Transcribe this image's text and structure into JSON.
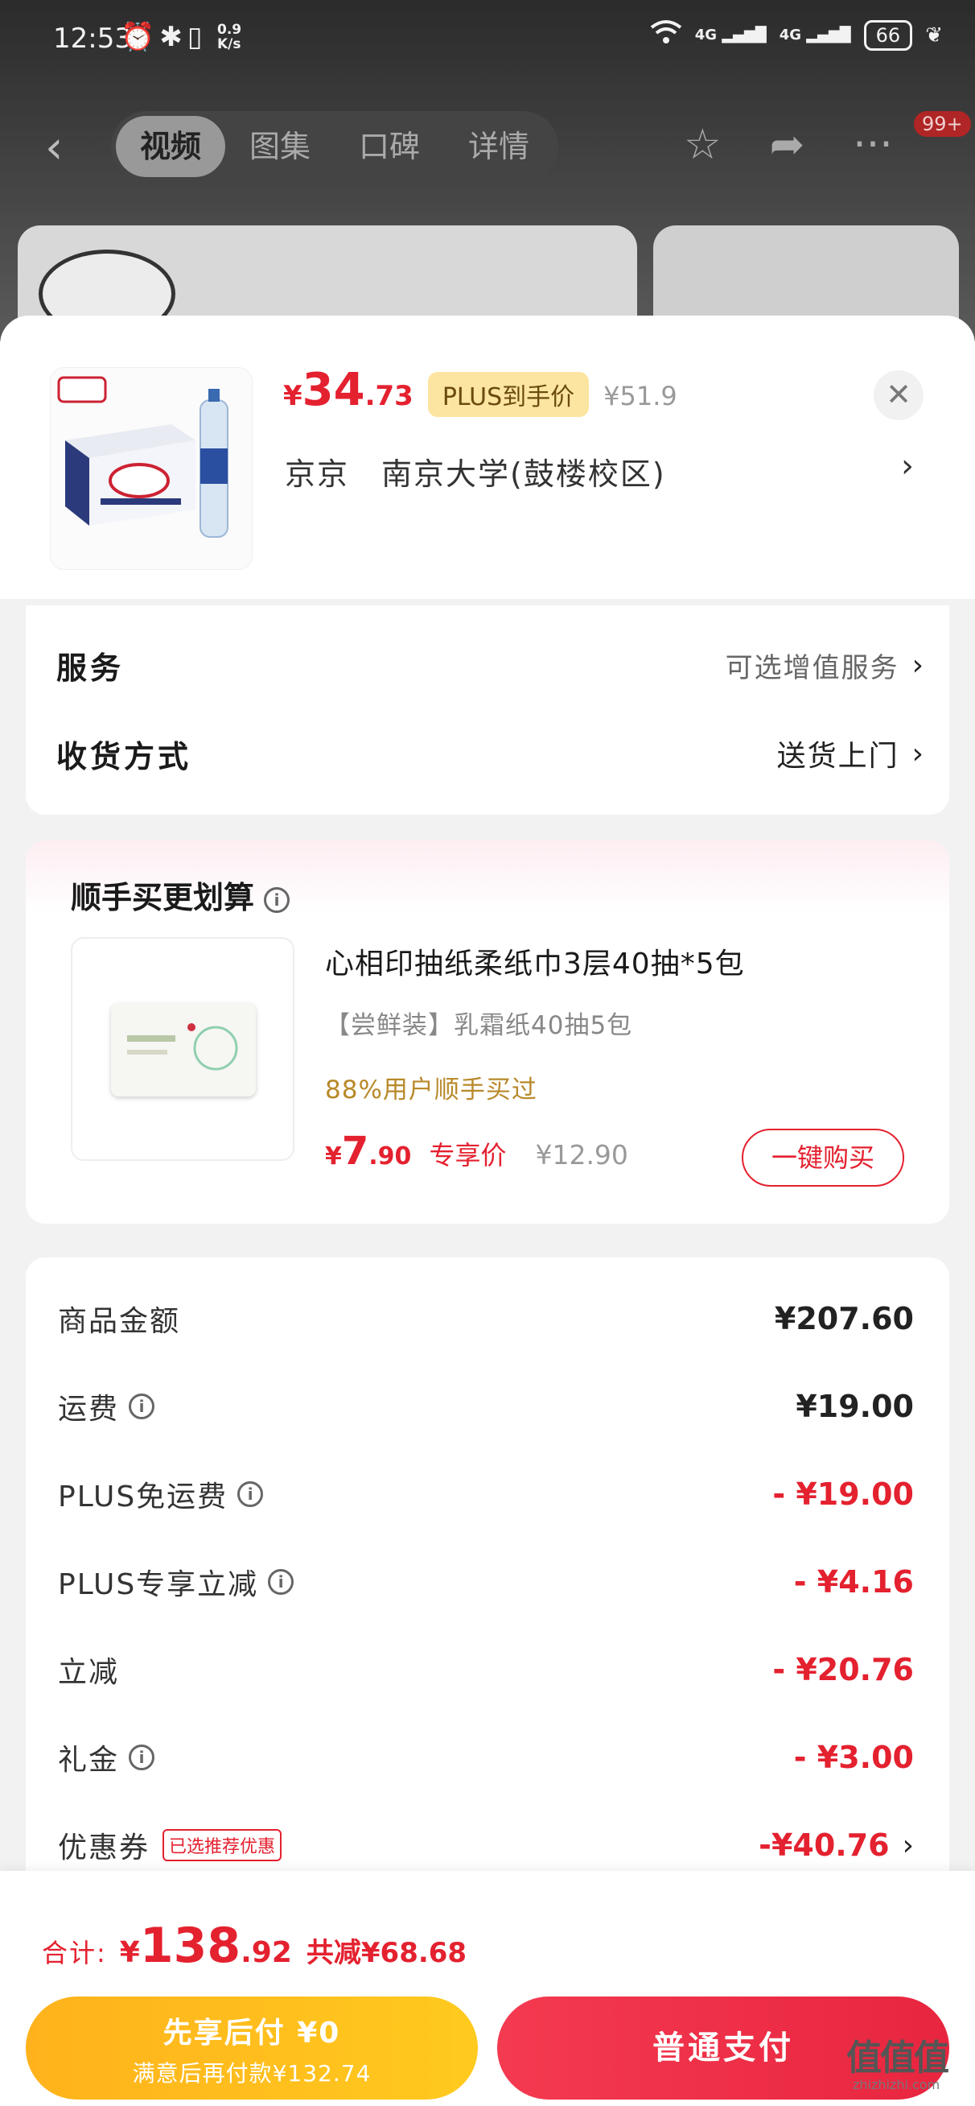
{
  "status_bar": {
    "time": "12:53",
    "speed_top": "0.9",
    "speed_unit": "K/s",
    "net1": "4G",
    "net2": "4G",
    "battery": "66"
  },
  "nav": {
    "tabs": [
      {
        "label": "视频"
      },
      {
        "label": "图集"
      },
      {
        "label": "口碑"
      },
      {
        "label": "详情"
      }
    ],
    "active_tab": "视频",
    "badge": "99+"
  },
  "product": {
    "price": {
      "currency": "¥",
      "integer": "34",
      "decimal": ".73"
    },
    "plus_tag": "PLUS到手价",
    "original_price": "¥51.9",
    "address": {
      "region": "京京",
      "detail": "南京大学(鼓楼校区)"
    }
  },
  "service": {
    "label": "服务",
    "value": "可选增值服务",
    "delivery_label": "收货方式",
    "delivery_value": "送货上门"
  },
  "recommend": {
    "title": "顺手买更划算",
    "name": "心相印抽纸柔纸巾3层40抽*5包",
    "spec": "【尝鲜装】乳霜纸40抽5包",
    "social": "88%用户顺手买过",
    "price": {
      "currency": "¥",
      "integer": "7",
      "decimal": ".90"
    },
    "exclusive": "专享价",
    "original_price": "¥12.90",
    "buy_button": "一键购买"
  },
  "summary": {
    "rows": [
      {
        "label": "商品金额",
        "value": "¥207.60"
      },
      {
        "label": "运费",
        "value": "¥19.00"
      },
      {
        "label": "PLUS免运费",
        "value": "- ¥19.00"
      },
      {
        "label": "PLUS专享立减",
        "value": "- ¥4.16"
      },
      {
        "label": "立减",
        "value": "- ¥20.76"
      },
      {
        "label": "礼金",
        "value": "- ¥3.00"
      },
      {
        "label": "优惠券",
        "value": "-¥40.76",
        "tag": "已选推荐优惠"
      }
    ]
  },
  "footer": {
    "total_label": "合计:",
    "total": {
      "currency": "¥",
      "integer": "138",
      "decimal": ".92"
    },
    "saved": "共减¥68.68",
    "pay_later_line1": "先享后付 ¥0",
    "pay_later_line2": "满意后再付款¥132.74",
    "pay_button": "普通支付"
  },
  "watermark": {
    "main": "值值值",
    "sub": "zhizhizhi.com"
  },
  "colors": {
    "accent": "#e4212f",
    "plus_tag_bg": "#fbe5a0",
    "pay_later": "#ffb21c",
    "pay": "#f43a50"
  }
}
